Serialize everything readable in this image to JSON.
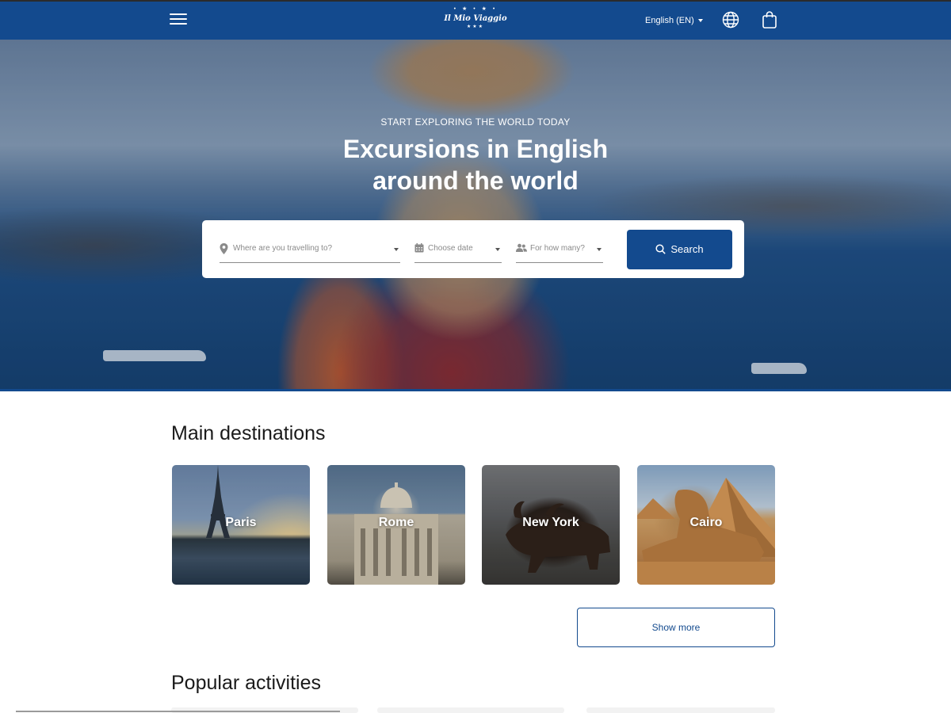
{
  "header": {
    "menu_icon": "hamburger-menu-icon",
    "logo": {
      "text": "Il Mio Viaggio",
      "stars": "• ★ • ★ •",
      "dots": "★★★"
    },
    "language": {
      "label": "English (EN)"
    },
    "globe_icon": "globe-icon",
    "bag_icon": "shopping-bag-icon",
    "colors": {
      "brand": "#134a8e"
    }
  },
  "hero": {
    "kicker": "START EXPLORING THE WORLD TODAY",
    "title_line1": "Excursions in English",
    "title_line2": "around the world"
  },
  "search": {
    "destination": {
      "placeholder": "Where are you travelling to?",
      "icon": "map-pin-icon"
    },
    "date": {
      "placeholder": "Choose date",
      "icon": "calendar-icon"
    },
    "people": {
      "placeholder": "For how many?",
      "icon": "people-icon"
    },
    "button": {
      "label": "Search",
      "icon": "search-icon"
    }
  },
  "destinations": {
    "title": "Main destinations",
    "items": [
      {
        "label": "Paris"
      },
      {
        "label": "Rome"
      },
      {
        "label": "New York"
      },
      {
        "label": "Cairo"
      }
    ],
    "show_more_label": "Show more"
  },
  "activities": {
    "title": "Popular activities"
  }
}
